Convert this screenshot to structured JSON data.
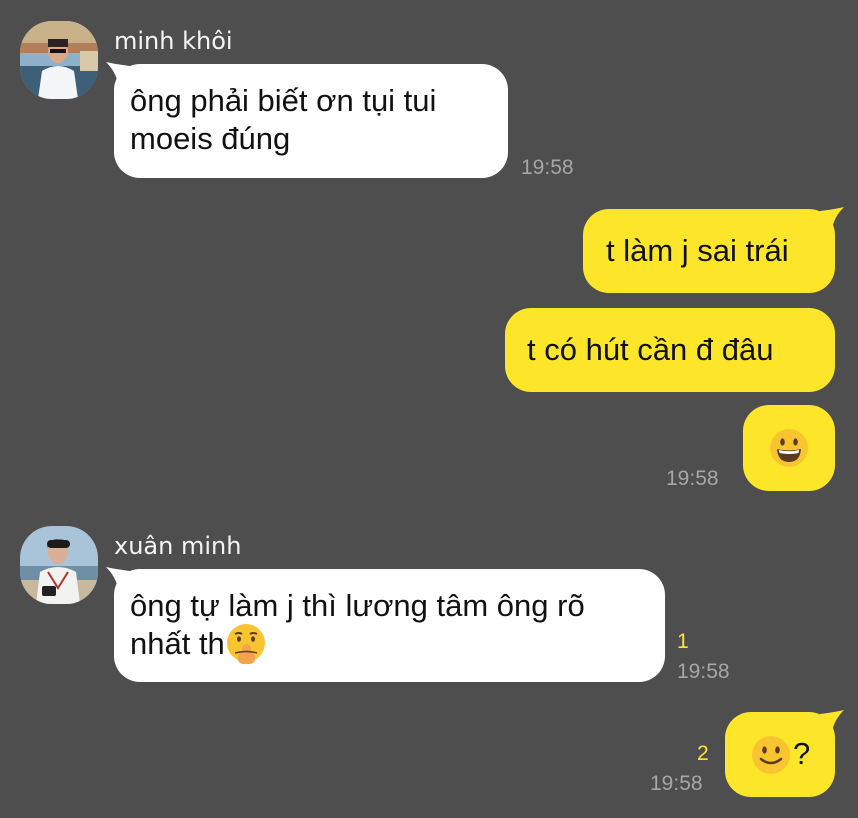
{
  "messages": [
    {
      "sender": "minh khôi",
      "direction": "incoming",
      "avatar": "profile-photo-man-sunglasses-harbor",
      "lines": [
        "ông phải biết ơn tụi tui",
        "moeis đúng"
      ],
      "time": "19:58"
    },
    {
      "direction": "outgoing",
      "text": "t làm j sai trái"
    },
    {
      "direction": "outgoing",
      "text": "t có hút cần đ đâu"
    },
    {
      "direction": "outgoing",
      "emoji": "grinning-face-emoji",
      "time": "19:58"
    },
    {
      "sender": "xuân minh",
      "direction": "incoming",
      "avatar": "profile-photo-man-camera-seaside",
      "lines": [
        "ông tự làm j thì lương tâm ông rõ",
        "nhất th"
      ],
      "trailing_emoji": "shushing-face-emoji",
      "unread": "1",
      "time": "19:58"
    },
    {
      "direction": "outgoing",
      "emoji": "slightly-smiling-face-emoji",
      "text_after_emoji": "?",
      "unread": "2",
      "time": "19:58"
    }
  ],
  "colors": {
    "background": "#4f4e4f",
    "incoming_bubble": "#ffffff",
    "outgoing_bubble": "#fde52a",
    "timestamp": "#a6a6a6",
    "unread_count": "#fde52a"
  }
}
